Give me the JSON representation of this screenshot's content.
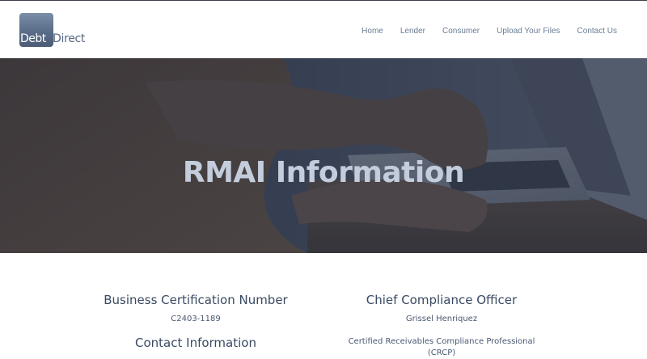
{
  "header": {
    "logo": {
      "word_1": "Debt",
      "word_2": "Direct"
    },
    "nav": [
      {
        "label": "Home"
      },
      {
        "label": "Lender"
      },
      {
        "label": "Consumer"
      },
      {
        "label": "Upload Your Files"
      },
      {
        "label": "Contact Us"
      }
    ]
  },
  "hero": {
    "title": "RMAI Information"
  },
  "content": {
    "left": {
      "business_cert_heading": "Business Certification Number",
      "business_cert_value": "C2403-1189",
      "contact_heading": "Contact Information"
    },
    "right": {
      "officer_heading": "Chief Compliance Officer",
      "officer_name": "Grissel Henriquez",
      "officer_credential": "Certified Receivables Compliance Professional (CRCP)"
    }
  },
  "colors": {
    "brand_blue": "#566780",
    "nav_text": "#6b7d96",
    "hero_title": "#c4cddb",
    "heading_text": "#3a4a63"
  }
}
